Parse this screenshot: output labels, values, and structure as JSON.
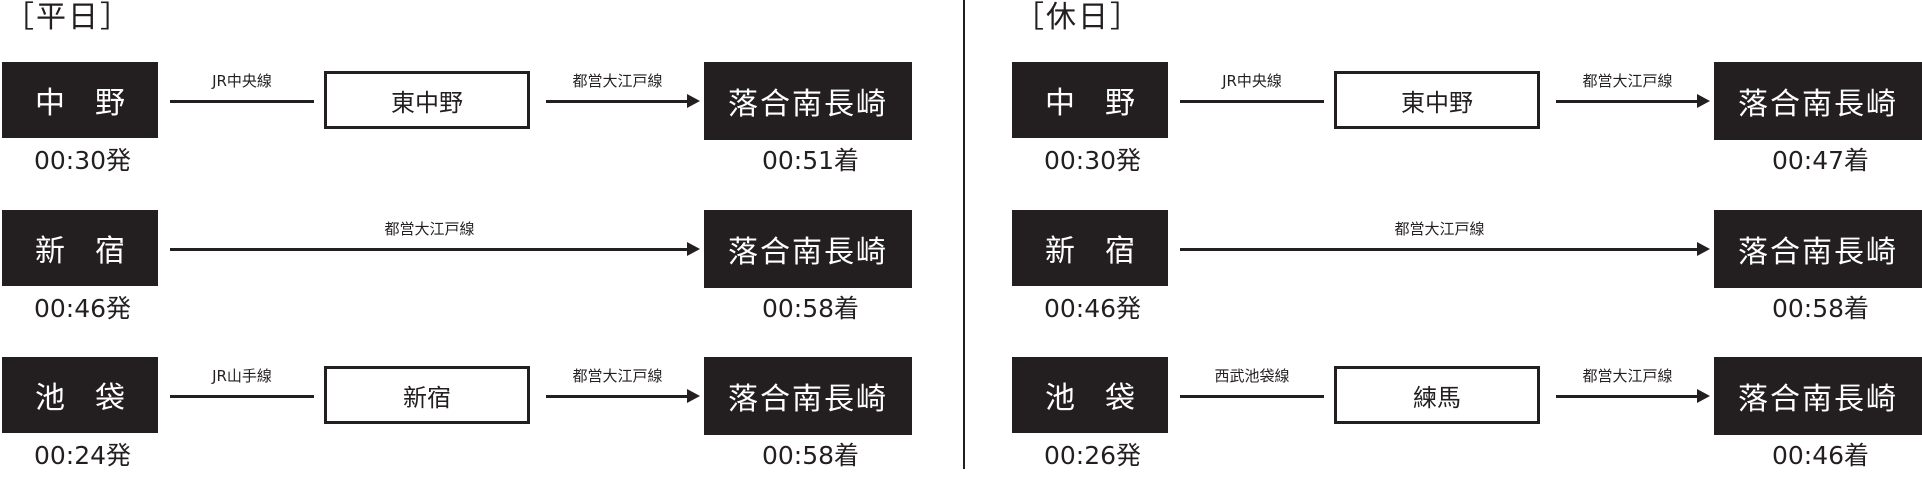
{
  "weekday": {
    "heading": "［平日］",
    "routes": [
      {
        "origin": "中　野",
        "departure": "00:30発",
        "line1": "JR中央線",
        "via": "東中野",
        "line2": "都営大江戸線",
        "destination": "落合南長崎",
        "arrival": "00:51着"
      },
      {
        "origin": "新　宿",
        "departure": "00:46発",
        "line": "都営大江戸線",
        "destination": "落合南長崎",
        "arrival": "00:58着"
      },
      {
        "origin": "池　袋",
        "departure": "00:24発",
        "line1": "JR山手線",
        "via": "新宿",
        "line2": "都営大江戸線",
        "destination": "落合南長崎",
        "arrival": "00:58着"
      }
    ]
  },
  "holiday": {
    "heading": "［休日］",
    "routes": [
      {
        "origin": "中　野",
        "departure": "00:30発",
        "line1": "JR中央線",
        "via": "東中野",
        "line2": "都営大江戸線",
        "destination": "落合南長崎",
        "arrival": "00:47着"
      },
      {
        "origin": "新　宿",
        "departure": "00:46発",
        "line": "都営大江戸線",
        "destination": "落合南長崎",
        "arrival": "00:58着"
      },
      {
        "origin": "池　袋",
        "departure": "00:26発",
        "line1": "西武池袋線",
        "via": "練馬",
        "line2": "都営大江戸線",
        "destination": "落合南長崎",
        "arrival": "00:46着"
      }
    ]
  },
  "colors": {
    "ink": "#231f20",
    "background": "#ffffff"
  }
}
